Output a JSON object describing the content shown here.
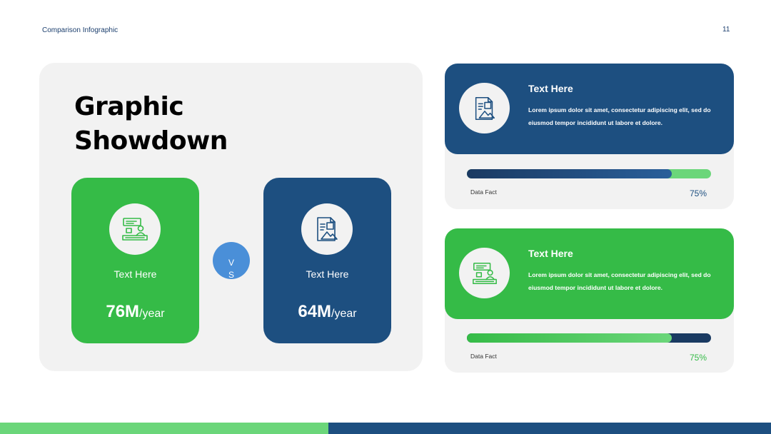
{
  "header": {
    "title": "Comparison Infographic",
    "page_number": "11"
  },
  "headline": {
    "line1": "Graphic",
    "line2": "Showdown"
  },
  "comparison": {
    "left": {
      "icon": "presenter-desk-icon",
      "label": "Text Here",
      "value": "76M",
      "unit": "/year",
      "color": "#35bb47"
    },
    "vs": {
      "line1": "V",
      "line2": "S"
    },
    "right": {
      "icon": "document-image-icon",
      "label": "Text Here",
      "value": "64M",
      "unit": "/year",
      "color": "#1d4f80"
    }
  },
  "info_cards": [
    {
      "icon": "document-image-icon",
      "title": "Text Here",
      "description": "Lorem ipsum dolor sit amet, consectetur adipiscing elit, sed do eiusmod tempor incididunt ut labore et dolore.",
      "fact_label": "Data Fact",
      "percent_text": "75%",
      "progress": 0.84,
      "color": "#1d4f80",
      "percent_color": "#1d4f80"
    },
    {
      "icon": "presenter-desk-icon",
      "title": "Text Here",
      "description": "Lorem ipsum dolor sit amet, consectetur adipiscing elit, sed do eiusmod tempor incididunt ut labore et dolore.",
      "fact_label": "Data Fact",
      "percent_text": "75%",
      "progress": 0.84,
      "color": "#35bb47",
      "percent_color": "#35bb47"
    }
  ]
}
